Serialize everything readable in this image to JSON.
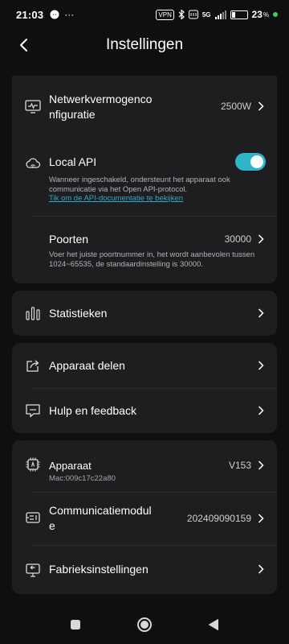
{
  "colors": {
    "accent": "#2fb3c7",
    "link": "#33a8c7",
    "card": "#1e1e20",
    "background": "#0f0f11"
  },
  "status_bar": {
    "time": "21:03",
    "battery": "23",
    "vpn": "VPN",
    "network": "5G",
    "more": "···"
  },
  "header": {
    "title": "Instellingen",
    "back_icon": "chevron-left-icon"
  },
  "sections": {
    "network": {
      "label_line1": "Netwerkvermogenco",
      "label_line2": "nfiguratie",
      "value": "2500W",
      "icon": "monitor-wave-icon"
    },
    "local_api": {
      "label": "Local API",
      "enabled": true,
      "description": "Wanneer ingeschakeld, ondersteunt het apparaat ook communicatie via het Open API-protocol.",
      "link": "Tik om de API-documentatie te bekijken",
      "icon": "cloud-wifi-icon"
    },
    "ports": {
      "label": "Poorten",
      "value": "30000",
      "description": "Voer het juiste poortnummer in, het wordt aanbevolen tussen 1024~65535, de standaardinstelling is 30000."
    },
    "statistics": {
      "label": "Statistieken",
      "icon": "bar-chart-icon"
    },
    "share": {
      "label": "Apparaat delen",
      "icon": "share-icon"
    },
    "help": {
      "label": "Hulp en feedback",
      "icon": "feedback-icon"
    },
    "device": {
      "label": "Apparaat",
      "sub": "Mac:009c17c22a80",
      "value": "V153",
      "icon": "chip-icon"
    },
    "comm_module": {
      "label_line1": "Communicatiemodul",
      "label_line2": "e",
      "value": "202409090159",
      "icon": "module-icon"
    },
    "factory": {
      "label": "Fabrieksinstellingen",
      "icon": "factory-reset-icon"
    }
  }
}
